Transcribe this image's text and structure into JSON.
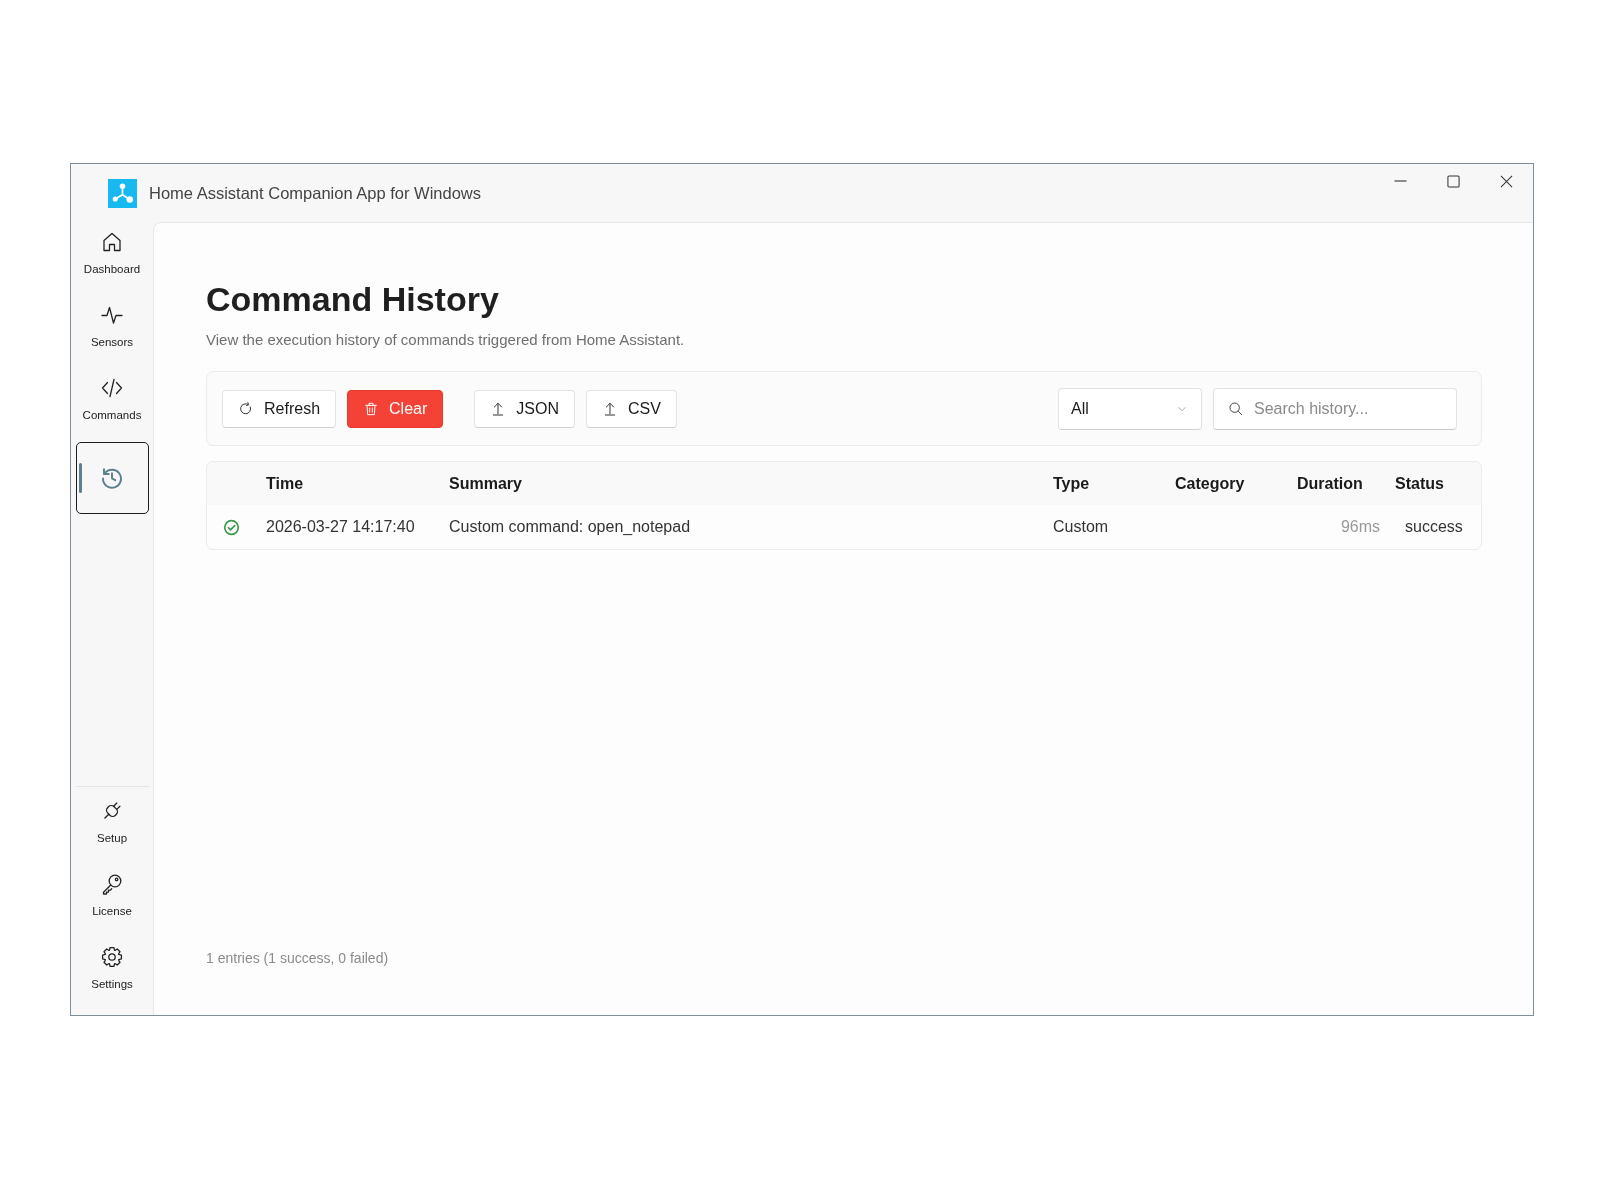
{
  "window": {
    "title": "Home Assistant Companion App for Windows"
  },
  "sidebar": {
    "items": [
      {
        "kind": "dashboard",
        "label": "Dashboard",
        "selected": false
      },
      {
        "kind": "sensors",
        "label": "Sensors",
        "selected": false
      },
      {
        "kind": "commands",
        "label": "Commands",
        "selected": false
      },
      {
        "kind": "history",
        "selected": true
      }
    ],
    "footer_items": [
      {
        "kind": "setup",
        "label": "Setup",
        "selected": false
      },
      {
        "kind": "license",
        "label": "License",
        "selected": false
      },
      {
        "kind": "settings",
        "label": "Settings",
        "selected": false
      }
    ]
  },
  "page": {
    "title": "Command History",
    "subtitle": "View the execution history of commands triggered from Home Assistant."
  },
  "toolbar": {
    "actions": [
      {
        "kind": "refresh",
        "label": "Refresh"
      },
      {
        "kind": "clear",
        "label": "Clear"
      }
    ],
    "exports": [
      {
        "kind": "export",
        "label": "JSON"
      },
      {
        "kind": "export",
        "label": "CSV"
      }
    ],
    "filter": {
      "value": "All"
    },
    "search": {
      "placeholder": "Search history..."
    }
  },
  "table": {
    "columns": [
      "Time",
      "Summary",
      "Type",
      "Category",
      "Duration",
      "Status"
    ],
    "rows": [
      {
        "color": "#3d9a4b",
        "time": "2026-03-27 14:17:40",
        "summary": "Custom command: open_notepad",
        "type": "Custom",
        "duration": "96ms",
        "status": "success"
      }
    ]
  },
  "status_bar": {
    "text": "1 entries (1 success, 0 failed)"
  }
}
